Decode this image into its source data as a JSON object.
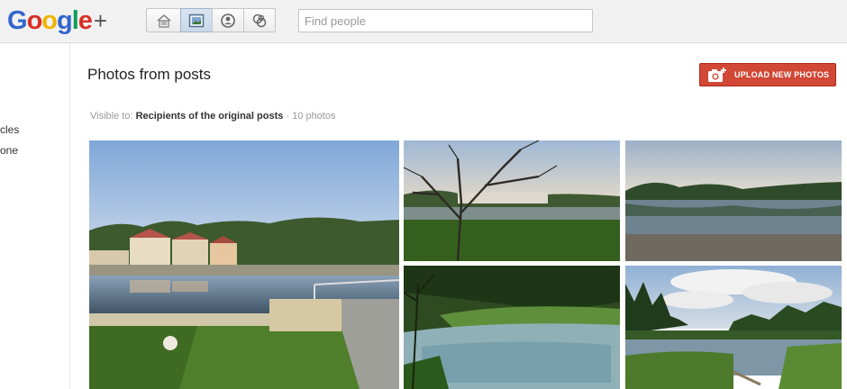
{
  "header": {
    "logo_text": [
      "G",
      "o",
      "o",
      "g",
      "l",
      "e"
    ],
    "logo_plus": "+",
    "nav": [
      {
        "name": "home-icon",
        "active": false
      },
      {
        "name": "photos-icon",
        "active": true
      },
      {
        "name": "profile-icon",
        "active": false
      },
      {
        "name": "circles-icon",
        "active": false
      }
    ],
    "search_placeholder": "Find people"
  },
  "sidebar": {
    "items": [
      "cles",
      "one"
    ]
  },
  "main": {
    "title": "Photos from posts",
    "upload_label": "UPLOAD NEW PHOTOS",
    "visible_prefix": "Visible to:",
    "visible_recipients": "Recipients of the original posts",
    "separator": "·",
    "photo_count": "10 photos"
  },
  "colors": {
    "accent": "#d14836",
    "header_bg": "#f1f1f1"
  }
}
